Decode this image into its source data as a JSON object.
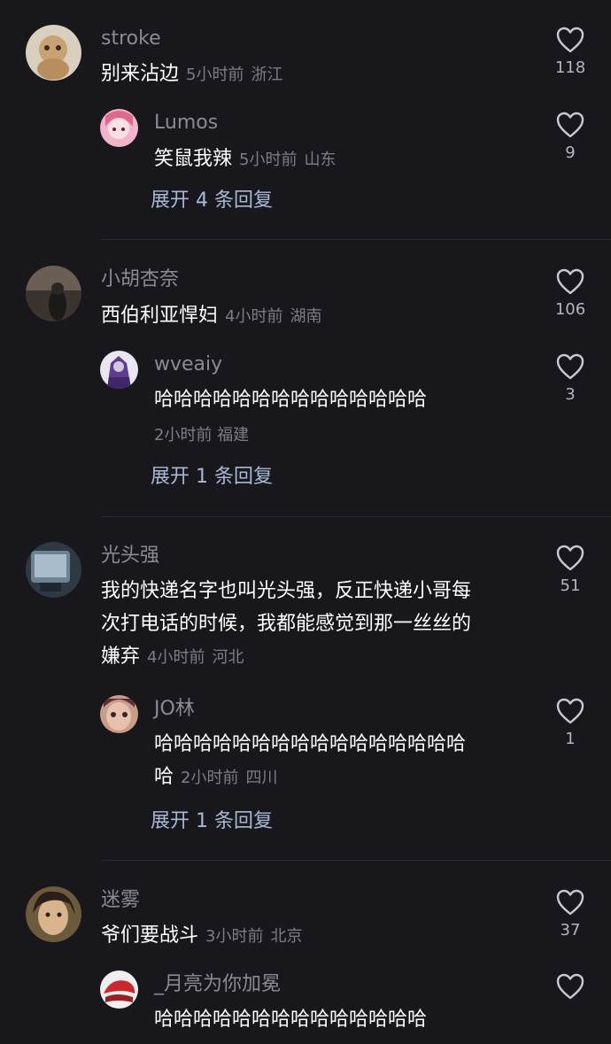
{
  "threads": [
    {
      "main": {
        "user": "stroke",
        "text": "别来沾边",
        "time": "5小时前",
        "location": "浙江",
        "likes": "118"
      },
      "reply": {
        "user": "Lumos",
        "text": "笑鼠我辣",
        "time": "5小时前",
        "location": "山东",
        "likes": "9"
      },
      "expand": "展开 4 条回复"
    },
    {
      "main": {
        "user": "小胡杏奈",
        "text": "西伯利亚悍妇",
        "time": "4小时前",
        "location": "湖南",
        "likes": "106"
      },
      "reply": {
        "user": "wveaiy",
        "text": "哈哈哈哈哈哈哈哈哈哈哈哈哈哈",
        "time": "2小时前",
        "location": "福建",
        "likes": "3"
      },
      "expand": "展开 1 条回复"
    },
    {
      "main": {
        "user": "光头强",
        "text_lines": [
          "我的快递名字也叫光头强，反正快递小哥每",
          "次打电话的时候，我都能感觉到那一丝丝的",
          "嫌弃"
        ],
        "time": "4小时前",
        "location": "河北",
        "likes": "51"
      },
      "reply": {
        "user": "JO林",
        "text_lines": [
          "哈哈哈哈哈哈哈哈哈哈哈哈哈哈哈哈",
          "哈"
        ],
        "time": "2小时前",
        "location": "四川",
        "likes": "1"
      },
      "expand": "展开 1 条回复"
    },
    {
      "main": {
        "user": "迷雾",
        "text": "爷们要战斗",
        "time": "3小时前",
        "location": "北京",
        "likes": "37"
      },
      "reply": {
        "user": "_月亮为你加冕",
        "text": "哈哈哈哈哈哈哈哈哈哈哈哈哈哈"
      }
    }
  ],
  "colors": {
    "background": "#17171c",
    "username": "#8b8b92",
    "meta": "#7d7d84",
    "expand": "#a9b8d6"
  },
  "icons": {
    "like": "heart-outline-icon"
  }
}
